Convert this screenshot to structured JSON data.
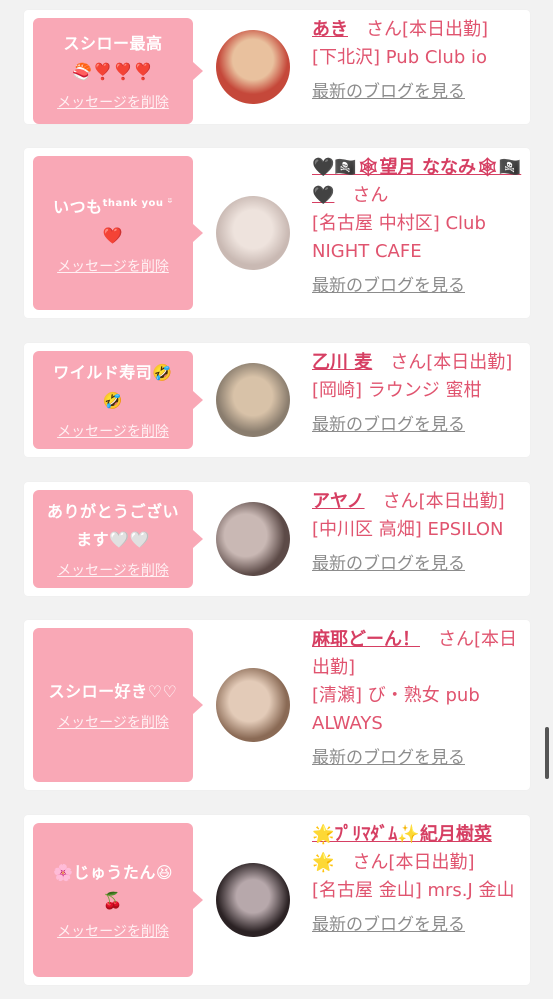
{
  "cards": [
    {
      "message": "スシロー最高",
      "emoji": "🍣❣️❣️❣️",
      "delete_label": "メッセージを削除",
      "name": "あき",
      "san": "さん",
      "status": "[本日出勤]",
      "shop": "[下北沢] Pub Club io",
      "blog_label": "最新のブログを見る",
      "avatar_colors": [
        "#c5483a",
        "#e9c19e"
      ]
    },
    {
      "message": "いつも",
      "message_sup": "thank you ᵕ̈",
      "emoji": "❤️",
      "delete_label": "メッセージを削除",
      "name": "🖤🏴‍☠️🕸望月 ななみ🕸🏴‍☠️🖤",
      "san": "さん",
      "status": "",
      "shop": "[名古屋 中村区] Club NIGHT CAFE",
      "blog_label": "最新のブログを見る",
      "avatar_colors": [
        "#c9b9b3",
        "#eee3dd"
      ]
    },
    {
      "message": "ワイルド寿司🤣",
      "emoji": "🤣",
      "delete_label": "メッセージを削除",
      "name": "乙川 麦",
      "san": "さん",
      "status": "[本日出勤]",
      "shop": "[岡崎] ラウンジ 蜜柑",
      "blog_label": "最新のブログを見る",
      "avatar_colors": [
        "#8a7d6e",
        "#d8c2a8"
      ]
    },
    {
      "message": "ありがとうござい",
      "emoji": "ます🤍🤍",
      "delete_label": "メッセージを削除",
      "name": "アヤノ",
      "san": "さん",
      "status": "[本日出勤]",
      "shop": "[中川区 高畑] EPSILON",
      "blog_label": "最新のブログを見る",
      "avatar_colors": [
        "#5c4a47",
        "#c9b8b4"
      ]
    },
    {
      "message": "スシロー好き♡♡",
      "emoji": "",
      "delete_label": "メッセージを削除",
      "name": "麻耶どーん！",
      "san": "さん",
      "status": "[本日出勤]",
      "shop": "[清瀬] び・熟女 pub ALWAYS",
      "blog_label": "最新のブログを見る",
      "avatar_colors": [
        "#8a6a55",
        "#e3cbb8"
      ]
    },
    {
      "message": "🌸じゅうたん😆",
      "emoji": "🍒",
      "delete_label": "メッセージを削除",
      "name": "🌟ﾌﾟﾘﾏﾀﾞﾑ✨紀月樹菜",
      "name_line2": "🌟",
      "san": "さん",
      "status": "[本日出勤]",
      "shop": "[名古屋 金山] mrs.J 金山",
      "blog_label": "最新のブログを見る",
      "avatar_colors": [
        "#2b2224",
        "#b7a8ab"
      ]
    }
  ]
}
